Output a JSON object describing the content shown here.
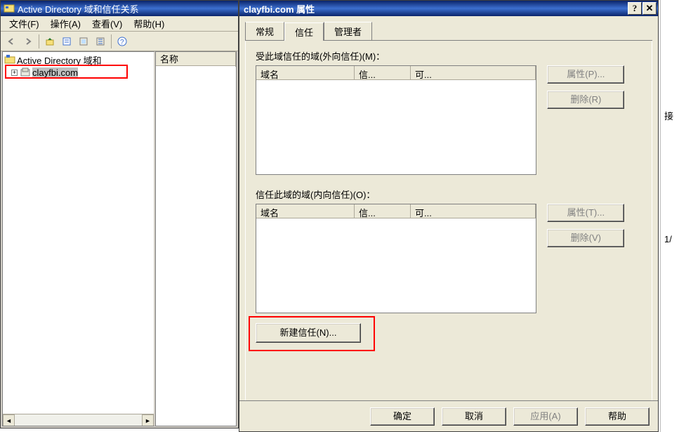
{
  "mmc": {
    "title": "Active Directory 域和信任关系",
    "menu": {
      "file": "文件(F)",
      "action": "操作(A)",
      "view": "查看(V)",
      "help": "帮助(H)"
    },
    "tree": {
      "root": "Active Directory 域和",
      "domain": "clayfbi.com"
    },
    "list": {
      "col_name": "名称"
    }
  },
  "dialog": {
    "title": "clayfbi.com 属性",
    "tabs": {
      "general": "常规",
      "trusts": "信任",
      "managed": "管理者"
    },
    "outgoing_label": "受此域信任的域(外向信任)(M)：",
    "incoming_label": "信任此域的域(内向信任)(O)：",
    "cols": {
      "domain": "域名",
      "trust": "信...",
      "trans": "可..."
    },
    "buttons": {
      "props_p": "属性(P)...",
      "remove_r": "删除(R)",
      "props_t": "属性(T)...",
      "remove_v": "删除(V)",
      "new_trust": "新建信任(N)...",
      "ok": "确定",
      "cancel": "取消",
      "apply": "应用(A)",
      "help": "帮助"
    }
  },
  "side": {
    "t1": "接",
    "t2": "1/"
  }
}
